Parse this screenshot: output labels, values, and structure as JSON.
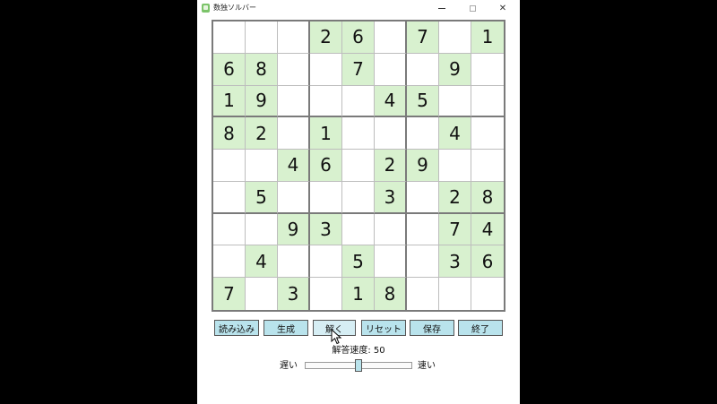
{
  "window": {
    "title": "数独ソルバー",
    "controls": {
      "minimize": "—",
      "maximize": "□",
      "close": "✕"
    }
  },
  "board": {
    "grid": [
      [
        "",
        "",
        "",
        "2",
        "6",
        "",
        "7",
        "",
        "1"
      ],
      [
        "6",
        "8",
        "",
        "",
        "7",
        "",
        "",
        "9",
        ""
      ],
      [
        "1",
        "9",
        "",
        "",
        "",
        "4",
        "5",
        "",
        ""
      ],
      [
        "8",
        "2",
        "",
        "1",
        "",
        "",
        "",
        "4",
        ""
      ],
      [
        "",
        "",
        "4",
        "6",
        "",
        "2",
        "9",
        "",
        ""
      ],
      [
        "",
        "5",
        "",
        "",
        "",
        "3",
        "",
        "2",
        "8"
      ],
      [
        "",
        "",
        "9",
        "3",
        "",
        "",
        "",
        "7",
        "4"
      ],
      [
        "",
        "4",
        "",
        "",
        "5",
        "",
        "",
        "3",
        "6"
      ],
      [
        "7",
        "",
        "3",
        "",
        "1",
        "8",
        "",
        "",
        ""
      ]
    ],
    "given_color": "#d8f1cf"
  },
  "buttons": {
    "load": "読み込み",
    "generate": "生成",
    "solve": "解く",
    "reset": "リセット",
    "save": "保存",
    "exit": "終了"
  },
  "speed": {
    "label": "解答速度: 50",
    "value": 50,
    "min": 0,
    "max": 100,
    "slow_label": "遅い",
    "fast_label": "速い"
  },
  "colors": {
    "button_bg": "#b9e3ec",
    "button_hover_bg": "#d6eef4"
  }
}
